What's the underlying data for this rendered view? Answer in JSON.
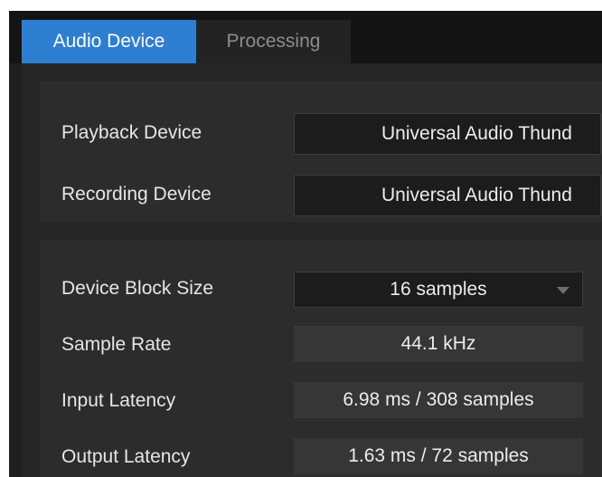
{
  "tabs": [
    {
      "label": "Audio Device",
      "active": true
    },
    {
      "label": "Processing",
      "active": false
    }
  ],
  "devices": {
    "playback_label": "Playback Device",
    "playback_value": "Universal Audio Thund",
    "recording_label": "Recording Device",
    "recording_value": "Universal Audio Thund"
  },
  "settings": {
    "block_size_label": "Device Block Size",
    "block_size_value": "16 samples",
    "sample_rate_label": "Sample Rate",
    "sample_rate_value": "44.1 kHz",
    "input_latency_label": "Input Latency",
    "input_latency_value": "6.98 ms / 308 samples",
    "output_latency_label": "Output Latency",
    "output_latency_value": "1.63 ms / 72 samples"
  },
  "colors": {
    "accent": "#2d7fd2",
    "background": "#1f1f1f",
    "panel": "#2c2c2c",
    "text": "#e6e6e6"
  },
  "icons": {
    "dropdown": "chevron-down-icon"
  }
}
